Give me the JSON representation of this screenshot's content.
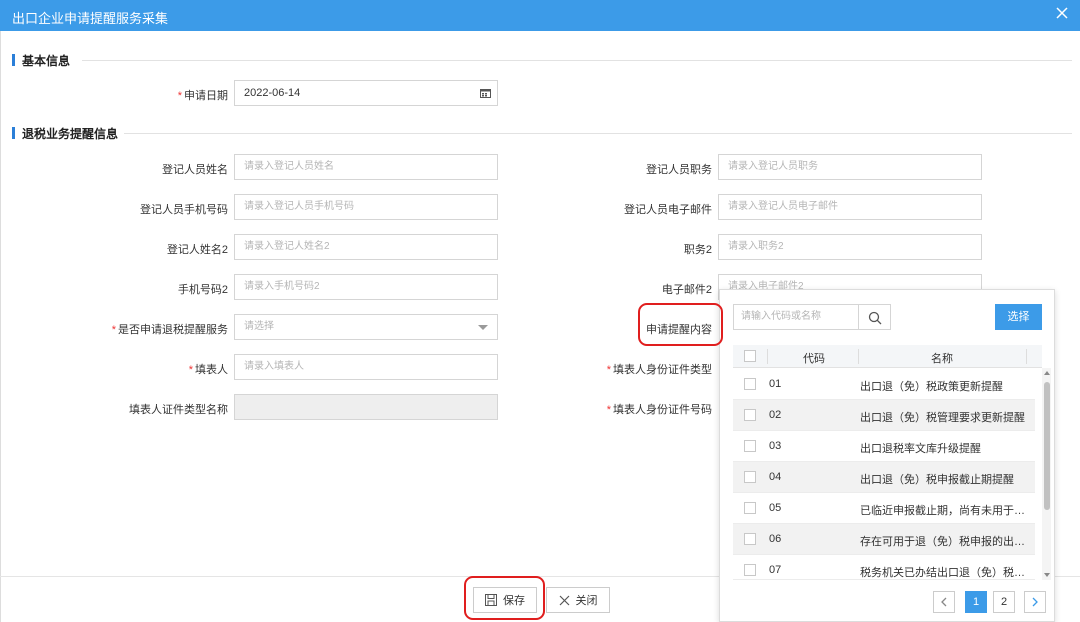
{
  "window": {
    "title": "出口企业申请提醒服务采集"
  },
  "sections": {
    "basic": "基本信息",
    "refund": "退税业务提醒信息"
  },
  "basic": {
    "apply_date_label": "申请日期",
    "apply_date_value": "2022-06-14"
  },
  "form": {
    "reg_name_label": "登记人员姓名",
    "reg_name_placeholder": "请录入登记人员姓名",
    "reg_post_label": "登记人员职务",
    "reg_post_placeholder": "请录入登记人员职务",
    "reg_phone_label": "登记人员手机号码",
    "reg_phone_placeholder": "请录入登记人员手机号码",
    "reg_email_label": "登记人员电子邮件",
    "reg_email_placeholder": "请录入登记人员电子邮件",
    "name2_label": "登记人姓名2",
    "name2_placeholder": "请录入登记人姓名2",
    "post2_label": "职务2",
    "post2_placeholder": "请录入职务2",
    "phone2_label": "手机号码2",
    "phone2_placeholder": "请录入手机号码2",
    "email2_label": "电子邮件2",
    "email2_placeholder": "请录入电子邮件2",
    "apply_service_label": "是否申请退税提醒服务",
    "apply_service_placeholder": "请选择",
    "remind_content_label": "申请提醒内容",
    "filler_label": "填表人",
    "filler_placeholder": "请录入填表人",
    "filler_idtype_label": "填表人身份证件类型",
    "filler_idtypename_label": "填表人证件类型名称",
    "filler_idno_label": "填表人身份证件号码"
  },
  "popup": {
    "search_placeholder": "请输入代码或名称",
    "select_label": "选择",
    "col_code": "代码",
    "col_name": "名称",
    "rows": [
      {
        "code": "01",
        "name": "出口退（免）税政策更新提醒"
      },
      {
        "code": "02",
        "name": "出口退（免）税管理要求更新提醒"
      },
      {
        "code": "03",
        "name": "出口退税率文库升级提醒"
      },
      {
        "code": "04",
        "name": "出口退（免）税申报截止期提醒"
      },
      {
        "code": "05",
        "name": "已临近申报截止期，尚有未用于退（免）税申报的出口货物报关单提醒"
      },
      {
        "code": "06",
        "name": "存在可用于退（免）税申报的出口货物报关单提醒"
      },
      {
        "code": "07",
        "name": "税务机关已办结出口退（免）税提醒"
      }
    ],
    "pages": [
      "1",
      "2"
    ]
  },
  "footer": {
    "save_label": "保存",
    "close_label": "关闭"
  },
  "colors": {
    "header": "#3c9be8",
    "highlight": "#e01e1e"
  }
}
